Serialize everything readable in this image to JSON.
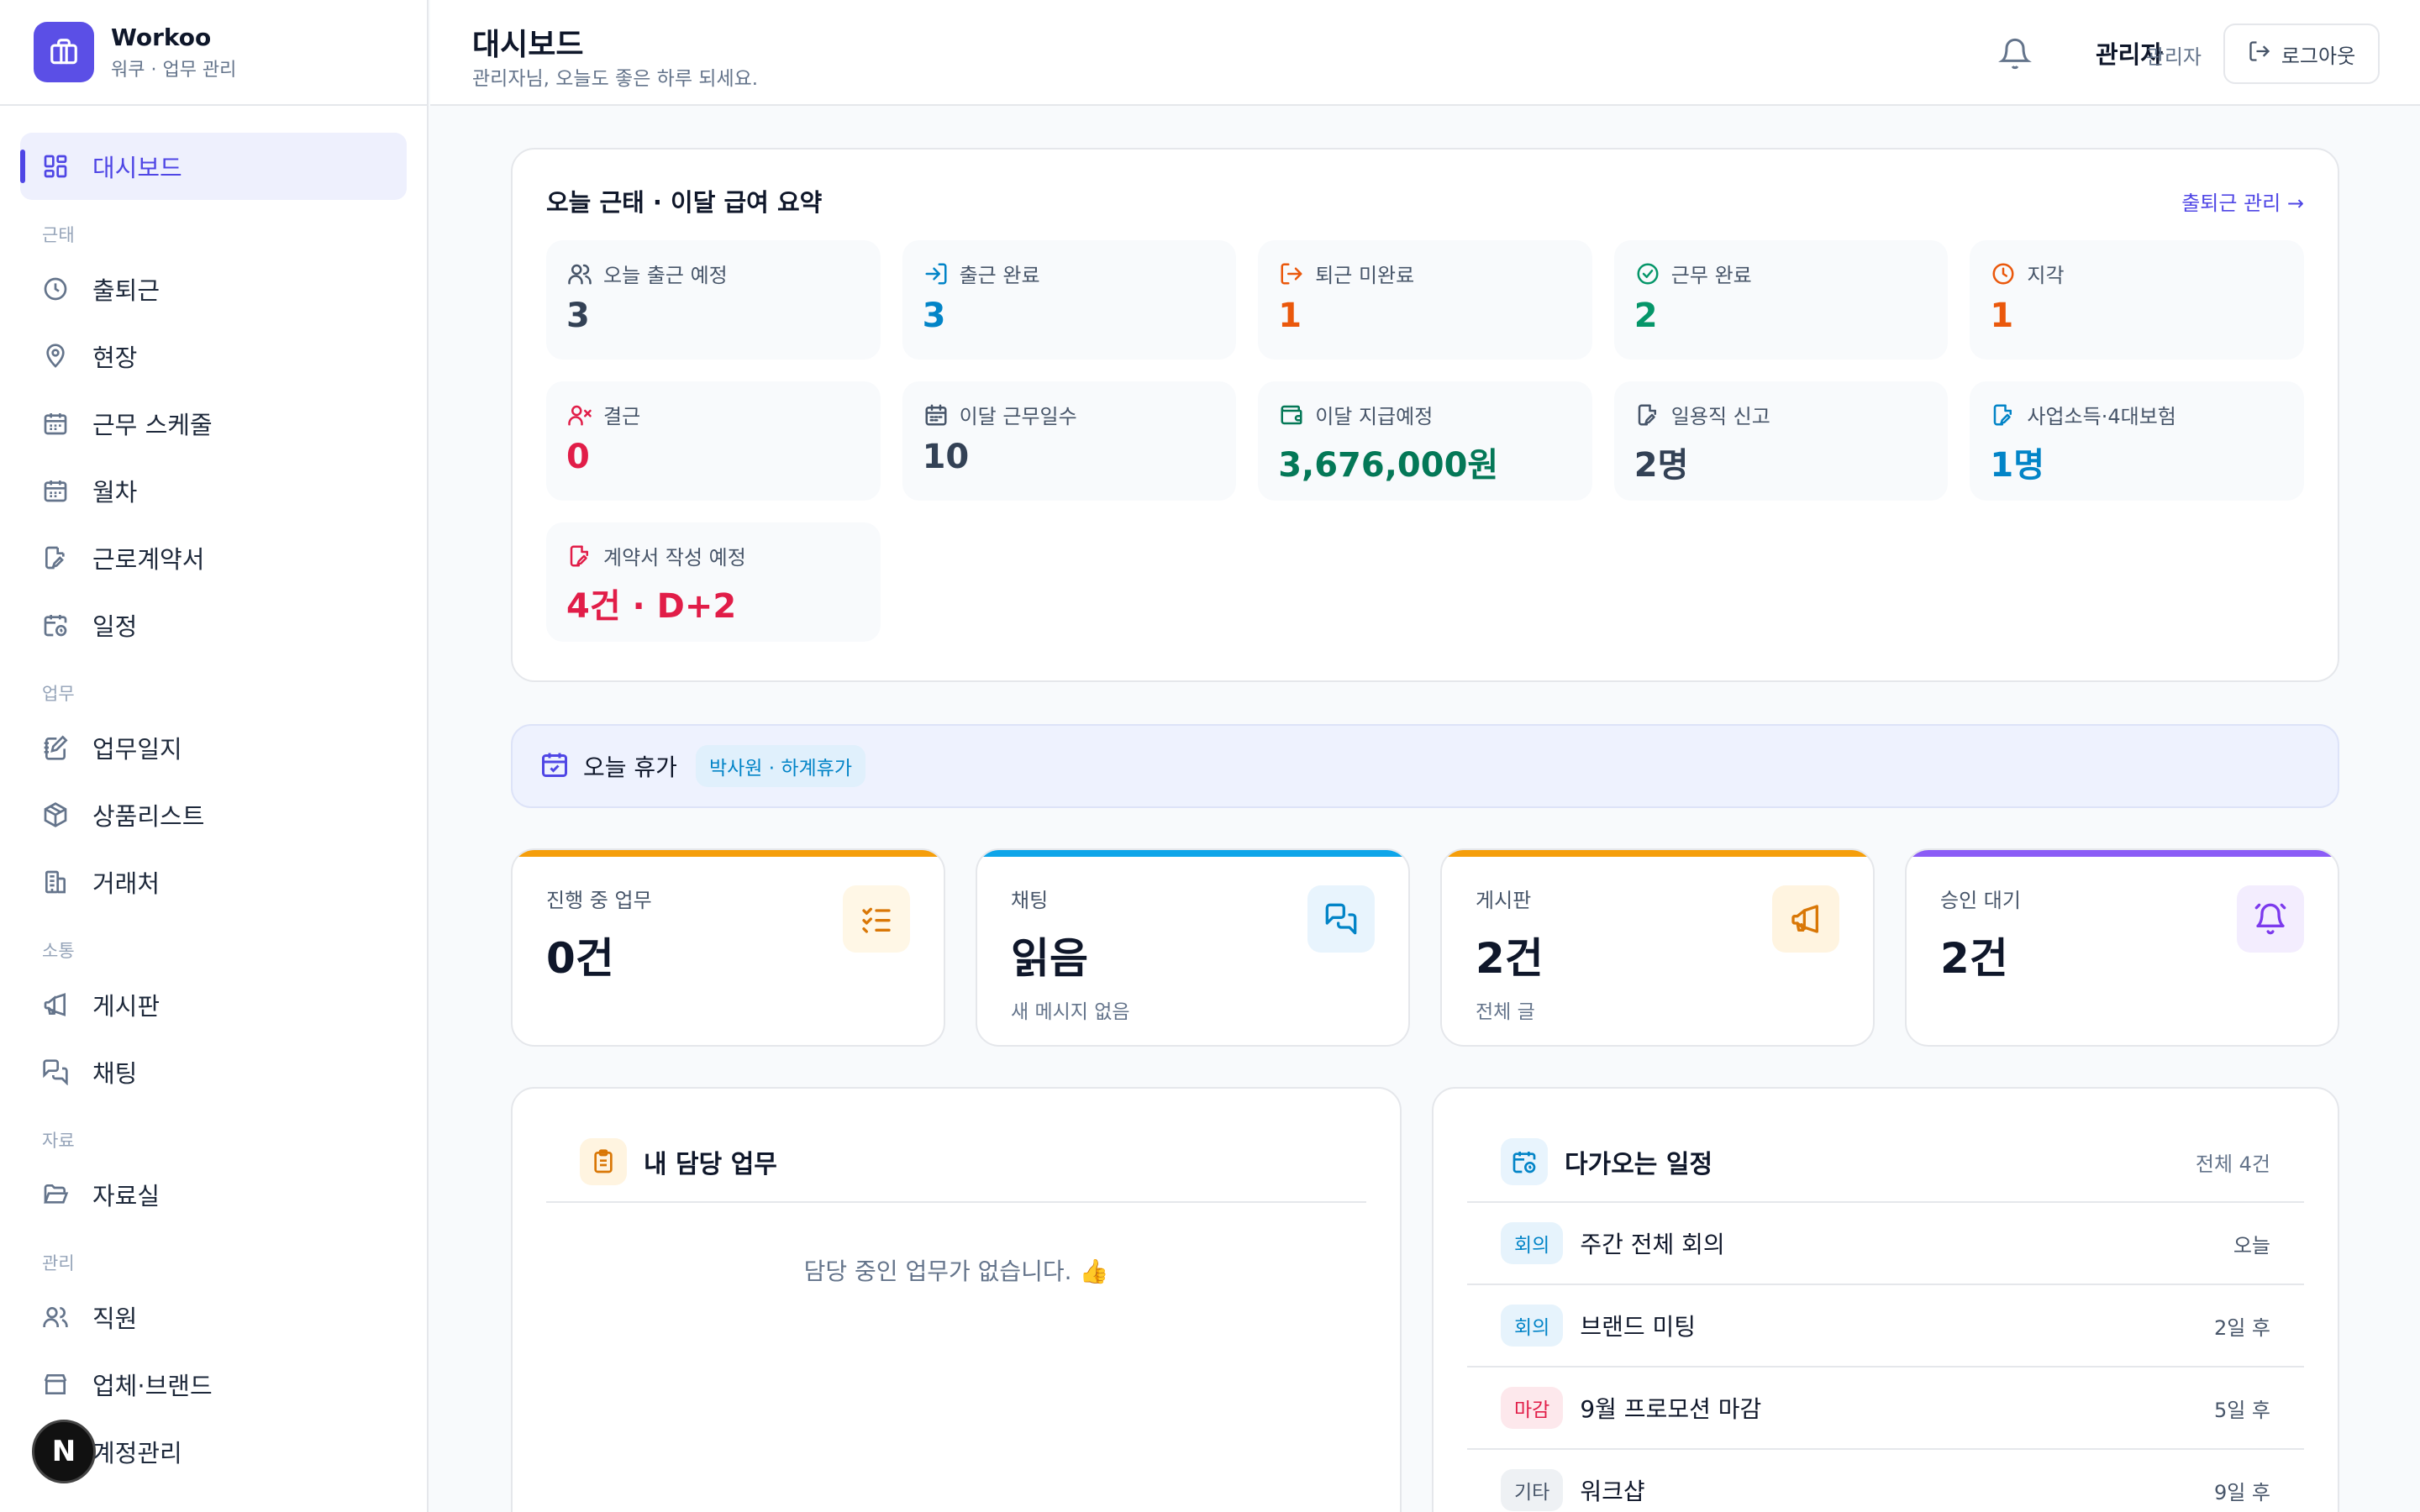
{
  "brand": {
    "name": "Workoo",
    "sub": "워쿠 · 업무 관리"
  },
  "nav": {
    "dashboard": "대시보드",
    "group_attendance": "근태",
    "commute": "출퇴근",
    "site": "현장",
    "schedule": "근무 스케줄",
    "leave": "월차",
    "contract": "근로계약서",
    "calendar": "일정",
    "group_work": "업무",
    "worklog": "업무일지",
    "products": "상품리스트",
    "clients": "거래처",
    "group_comm": "소통",
    "board": "게시판",
    "chat": "채팅",
    "group_files": "자료",
    "files": "자료실",
    "group_admin": "관리",
    "staff": "직원",
    "brands": "업체·브랜드",
    "accounts": "계정관리"
  },
  "header": {
    "title": "대시보드",
    "subtitle": "관리자님, 오늘도 좋은 하루 되세요.",
    "user_name": "관리자",
    "user_role": "관리자",
    "logout": "로그아웃"
  },
  "summary": {
    "title": "오늘 근태 · 이달 급여 요약",
    "link": "출퇴근 관리 →",
    "stats": [
      {
        "label": "오늘 출근 예정",
        "value": "3",
        "color": "#334155",
        "icon": "users-icon"
      },
      {
        "label": "출근 완료",
        "value": "3",
        "color": "#0284c7",
        "icon": "login-icon"
      },
      {
        "label": "퇴근 미완료",
        "value": "1",
        "color": "#ea580c",
        "icon": "logout-icon"
      },
      {
        "label": "근무 완료",
        "value": "2",
        "color": "#059669",
        "icon": "check-circle-icon"
      },
      {
        "label": "지각",
        "value": "1",
        "color": "#ea580c",
        "icon": "clock-icon"
      },
      {
        "label": "결근",
        "value": "0",
        "color": "#e11d48",
        "icon": "user-x-icon"
      },
      {
        "label": "이달 근무일수",
        "value": "10",
        "color": "#334155",
        "icon": "calendar-icon"
      },
      {
        "label": "이달 지급예정",
        "value": "3,676,000원",
        "color": "#047857",
        "icon": "wallet-icon"
      },
      {
        "label": "일용직 신고",
        "value": "2명",
        "color": "#334155",
        "icon": "file-edit-icon"
      },
      {
        "label": "사업소득·4대보험",
        "value": "1명",
        "color": "#0284c7",
        "icon": "file-edit-icon"
      },
      {
        "label": "계약서 작성 예정",
        "value": "4건 · D+2",
        "color": "#e11d48",
        "icon": "file-edit-icon"
      }
    ]
  },
  "leave": {
    "title": "오늘 휴가",
    "tag": "박사원 · 하계휴가"
  },
  "kpis": [
    {
      "label": "진행 중 업무",
      "value": "0건",
      "sub": "",
      "bar": "#f59e0b",
      "icon": "checklist-icon",
      "icon_bg": "#fff7e6",
      "icon_color": "#d97706"
    },
    {
      "label": "채팅",
      "value": "읽음",
      "sub": "새 메시지 없음",
      "bar": "#0ea5e9",
      "icon": "chat-icon",
      "icon_bg": "#e8f4fd",
      "icon_color": "#0284c7"
    },
    {
      "label": "게시판",
      "value": "2건",
      "sub": "전체 글",
      "bar": "#f59e0b",
      "icon": "megaphone-icon",
      "icon_bg": "#fff4e0",
      "icon_color": "#d97706"
    },
    {
      "label": "승인 대기",
      "value": "2건",
      "sub": "",
      "bar": "#8b5cf6",
      "icon": "alarm-icon",
      "icon_bg": "#f3edfe",
      "icon_color": "#7c3aed"
    }
  ],
  "tasks": {
    "title": "내 담당 업무",
    "empty": "담당 중인 업무가 없습니다. 👍"
  },
  "upcoming": {
    "title": "다가오는 일정",
    "count": "전체 4건",
    "events": [
      {
        "tag": "회의",
        "title": "주간 전체 회의",
        "when": "오늘",
        "tag_color": "#0284c7",
        "tag_bg": "#e6f3fc"
      },
      {
        "tag": "회의",
        "title": "브랜드 미팅",
        "when": "2일 후",
        "tag_color": "#0284c7",
        "tag_bg": "#e6f3fc"
      },
      {
        "tag": "마감",
        "title": "9월 프로모션 마감",
        "when": "5일 후",
        "tag_color": "#e11d48",
        "tag_bg": "#fde8ec"
      },
      {
        "tag": "기타",
        "title": "워크샵",
        "when": "9일 후",
        "tag_color": "#475569",
        "tag_bg": "#eef1f4"
      }
    ]
  },
  "colors": {
    "accent": "#4f46e5",
    "brand": "#5b4fe6"
  }
}
